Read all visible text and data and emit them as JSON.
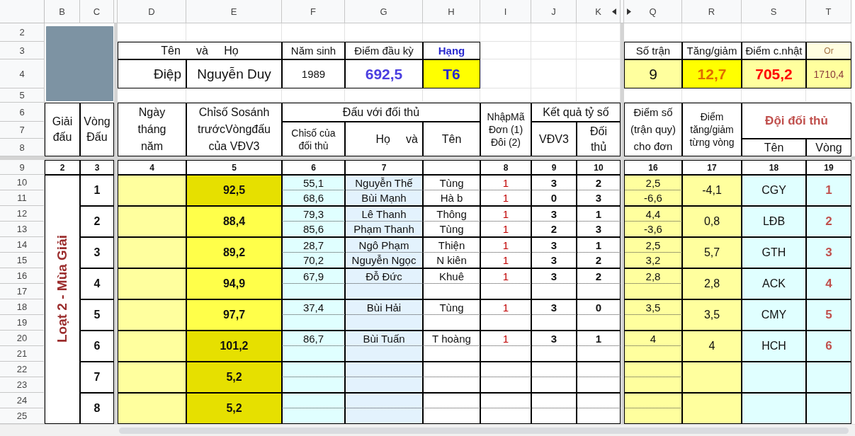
{
  "column_headers": [
    "B",
    "C",
    "D",
    "E",
    "F",
    "G",
    "H",
    "I",
    "J",
    "K",
    "Q",
    "R",
    "S",
    "T"
  ],
  "row_numbers": [
    "2",
    "3",
    "4",
    "5",
    "6",
    "7",
    "8",
    "9",
    "10",
    "11",
    "12",
    "13",
    "14",
    "15",
    "16",
    "17",
    "18",
    "19",
    "20",
    "21",
    "22",
    "23",
    "24",
    "25"
  ],
  "profile": {
    "name_label": "Tên     và     Họ",
    "birth_year_label": "Năm sinh",
    "start_score_label": "Điểm đầu kỳ",
    "rank_label": "Hạng",
    "first_name": "Điệp",
    "last_name": "Nguyễn Duy",
    "birth_year": "1989",
    "start_score": "692,5",
    "rank": "T6"
  },
  "summary": {
    "matches_label": "Số trận",
    "change_label": "Tăng/giảm",
    "updated_label": "Điểm c.nhật",
    "or_label": "Or",
    "matches": "9",
    "change": "12,7",
    "updated": "705,2",
    "or_value": "1710,4"
  },
  "table_headers": {
    "tournament": "Giải đấu",
    "round": "Vòng Đấu",
    "date": "Ngày tháng năm",
    "pre_index": "Chỉsố Sosánh trướcVòngđấu của VĐV3",
    "opponent_group": "Đấu với đối thủ",
    "opponent_index": "Chỉsố của đối thủ",
    "opponent_surname": "Họ     và",
    "opponent_name": "Tên",
    "code": "NhậpMã Đơn (1) Đôi (2)",
    "result_group": "Kết quả tỷ số",
    "own_score": "VĐV3",
    "opp_score": "Đối thủ",
    "points": "Điểm số (trận quy) cho đơn",
    "round_change": "Điểm tăng/giảm từng vòng",
    "team_group": "Đội đối thủ",
    "team_name": "Tên",
    "team_round": "Vòng"
  },
  "column_numbers": [
    "2",
    "3",
    "4",
    "5",
    "6",
    "7",
    "8",
    "9",
    "10",
    "16",
    "17",
    "18",
    "19"
  ],
  "tournament_label": "Loạt 2 - Mùa Giải",
  "rounds": [
    {
      "round": "1",
      "pre_index": "92,5",
      "highlighted": true,
      "change": "-4,1",
      "team": "CGY",
      "team_round": "1",
      "matches": [
        {
          "index": "55,1",
          "surname": "Nguyễn Thế",
          "name": "Tùng",
          "code": "1",
          "own": "3",
          "opp": "2",
          "points": "2,5"
        },
        {
          "index": "68,6",
          "surname": "Bùi Mạnh",
          "name": "Hà b",
          "code": "1",
          "own": "0",
          "opp": "3",
          "points": "-6,6"
        }
      ]
    },
    {
      "round": "2",
      "pre_index": "88,4",
      "highlighted": false,
      "change": "0,8",
      "team": "LĐB",
      "team_round": "2",
      "matches": [
        {
          "index": "79,3",
          "surname": "Lê Thanh",
          "name": "Thông",
          "code": "1",
          "own": "3",
          "opp": "1",
          "points": "4,4"
        },
        {
          "index": "85,6",
          "surname": "Phạm Thanh",
          "name": "Tùng",
          "code": "1",
          "own": "2",
          "opp": "3",
          "points": "-3,6"
        }
      ]
    },
    {
      "round": "3",
      "pre_index": "89,2",
      "highlighted": false,
      "change": "5,7",
      "team": "GTH",
      "team_round": "3",
      "matches": [
        {
          "index": "28,7",
          "surname": "Ngô Phạm",
          "name": "Thiện",
          "code": "1",
          "own": "3",
          "opp": "1",
          "points": "2,5"
        },
        {
          "index": "70,2",
          "surname": "Nguyễn Ngọc",
          "name": "N kiên",
          "code": "1",
          "own": "3",
          "opp": "2",
          "points": "3,2"
        }
      ]
    },
    {
      "round": "4",
      "pre_index": "94,9",
      "highlighted": false,
      "change": "2,8",
      "team": "ACK",
      "team_round": "4",
      "matches": [
        {
          "index": "67,9",
          "surname": "Đỗ Đức",
          "name": "Khuê",
          "code": "1",
          "own": "3",
          "opp": "2",
          "points": "2,8"
        }
      ]
    },
    {
      "round": "5",
      "pre_index": "97,7",
      "highlighted": false,
      "change": "3,5",
      "team": "CMY",
      "team_round": "5",
      "matches": [
        {
          "index": "37,4",
          "surname": "Bùi Hải",
          "name": "Tùng",
          "code": "1",
          "own": "3",
          "opp": "0",
          "points": "3,5"
        }
      ]
    },
    {
      "round": "6",
      "pre_index": "101,2",
      "highlighted": true,
      "change": "4",
      "team": "HCH",
      "team_round": "6",
      "matches": [
        {
          "index": "86,7",
          "surname": "Bùi Tuấn",
          "name": "T hoàng",
          "code": "1",
          "own": "3",
          "opp": "1",
          "points": "4"
        }
      ]
    },
    {
      "round": "7",
      "pre_index": "5,2",
      "highlighted": true
    },
    {
      "round": "8",
      "pre_index": "5,2",
      "highlighted": true
    }
  ]
}
